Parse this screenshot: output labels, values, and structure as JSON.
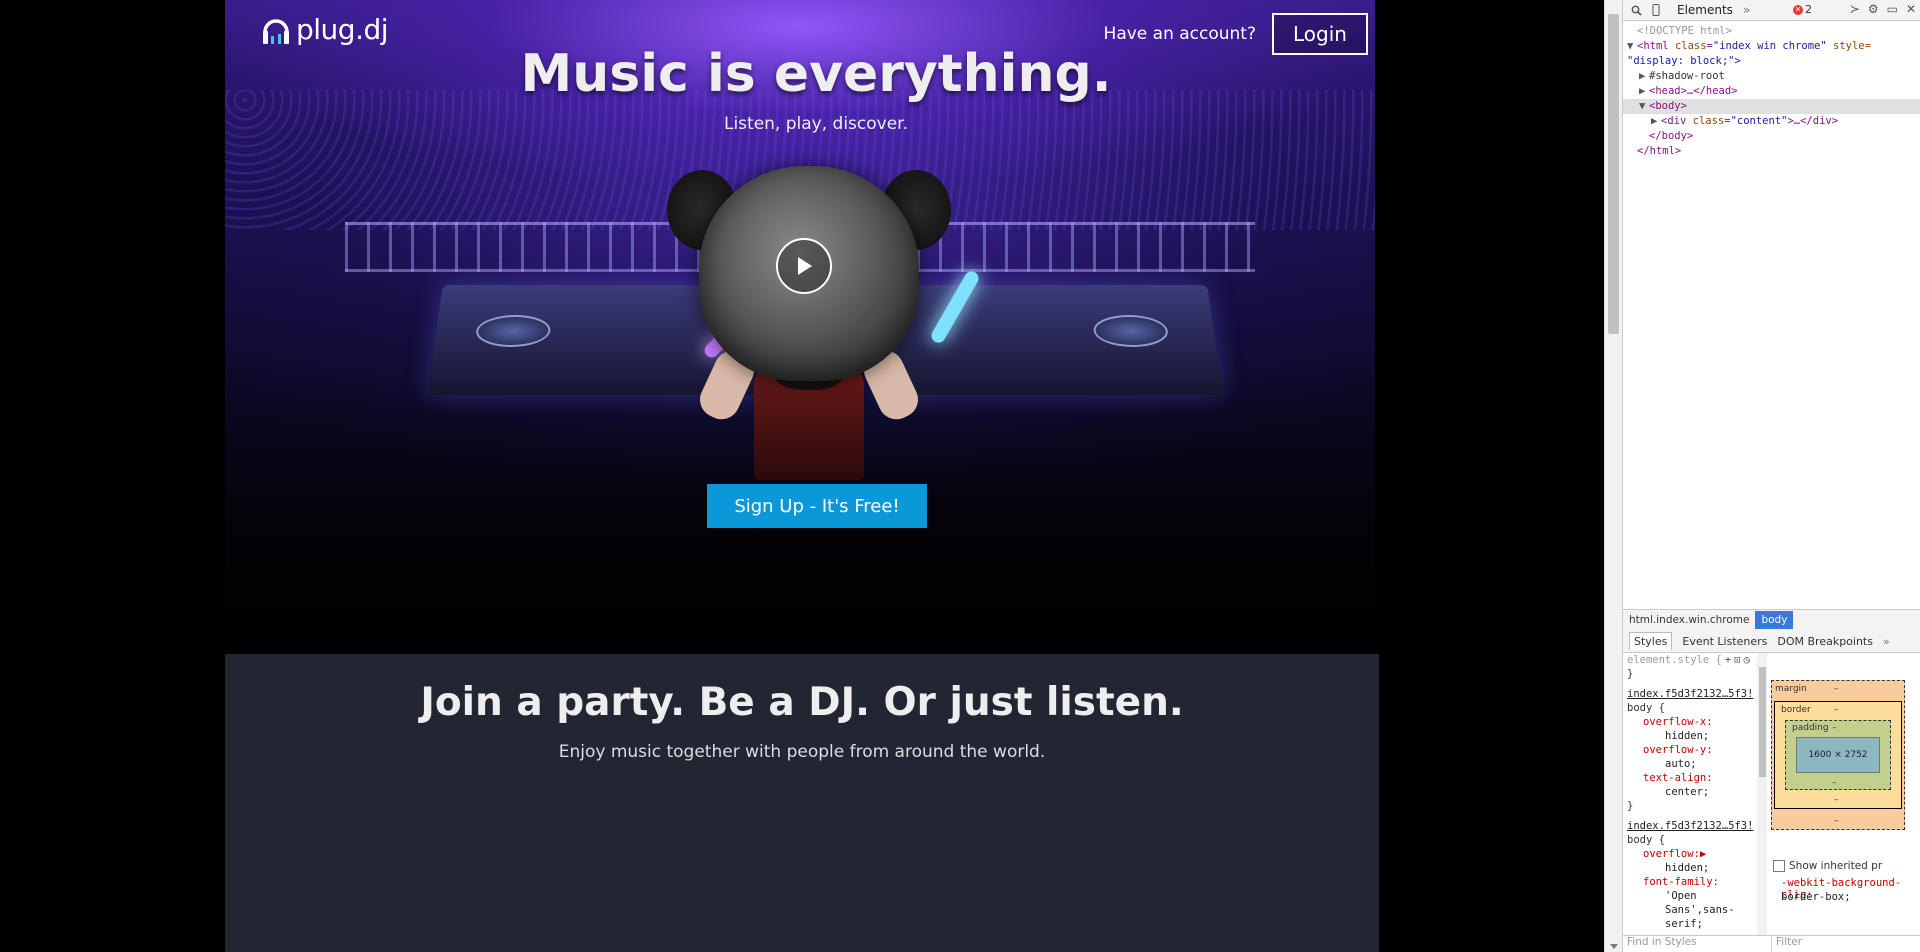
{
  "brand": {
    "name": "plug.dj"
  },
  "header": {
    "account_prompt": "Have an account?",
    "login_label": "Login"
  },
  "hero": {
    "title": "Music is everything.",
    "subtitle": "Listen, play, discover.",
    "signup_label": "Sign Up - It's Free!"
  },
  "features": {
    "title": "Join a party. Be a DJ. Or just listen.",
    "subtitle": "Enjoy music together with people from around the world."
  },
  "devtools": {
    "tab": "Elements",
    "more": "»",
    "error_count": "2",
    "dom": {
      "doctype": "<!DOCTYPE html>",
      "html_open": "<html",
      "html_class_name": "class",
      "html_class_value": "\"index win chrome\"",
      "html_style_name": "style=",
      "html_style_value": "\"display: block;\">",
      "shadow_root": "#shadow-root",
      "head": "<head>…</head>",
      "body_open": "<body>",
      "div_open": "<div",
      "div_class_name": "class",
      "div_class_value": "\"content\"",
      "div_close": ">…</div>",
      "body_close": "</body>",
      "html_close": "</html>"
    },
    "breadcrumb": {
      "html": "html.index.win.chrome",
      "body": "body"
    },
    "subtabs": {
      "styles": "Styles",
      "listeners": "Event Listeners",
      "breakpoints": "DOM Breakpoints",
      "more": "»"
    },
    "styles": {
      "element_style": "element.style {",
      "close1": "}",
      "rule1_source": "index.f5d3f2132…5f3!",
      "rule1_selector": "body {",
      "rule1_props": [
        {
          "name": "overflow-x:",
          "value": "hidden;"
        },
        {
          "name": "overflow-y:",
          "value": "auto;"
        },
        {
          "name": "text-align:",
          "value": "center;"
        }
      ],
      "close2": "}",
      "rule2_source": "index.f5d3f2132…5f3!",
      "rule2_selector": "body {",
      "rule2_props": [
        {
          "name": "overflow:▶",
          "value": "hidden;"
        },
        {
          "name": "font-family:",
          "value": "'Open"
        }
      ],
      "rule2_cont1": "Sans',sans-",
      "rule2_cont2": "serif;"
    },
    "box_model": {
      "margin_label": "margin",
      "border_label": "border",
      "padding_label": "padding",
      "content_size": "1600 × 2752",
      "dash": "–"
    },
    "show_inherited": "Show inherited pr",
    "webkit_prop": "-webkit-background-clip:",
    "webkit_val": "border-box;",
    "find_placeholder": "Find in Styles",
    "filter_placeholder": "Filter"
  },
  "colors": {
    "signup_bg": "#0b98d8",
    "features_bg": "#222532",
    "logo_accent": "#3fc6e8"
  }
}
